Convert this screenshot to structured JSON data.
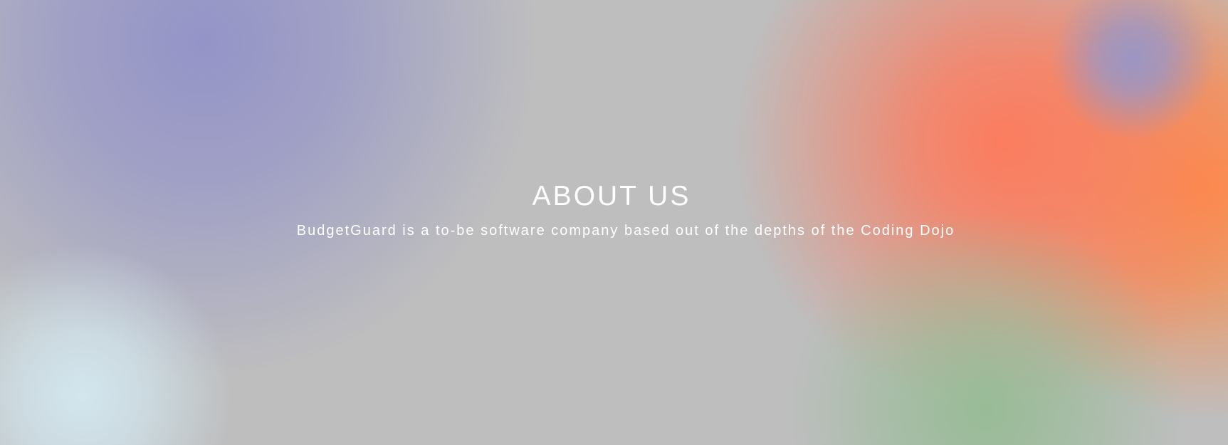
{
  "hero": {
    "title": "ABOUT US",
    "subtitle": "BudgetGuard is a to-be software company based out of the depths of the Coding Dojo"
  },
  "colors": {
    "background": "#bebebf",
    "text": "#ffffff",
    "blob_purple": "#9494c8",
    "blob_coral": "#fc7c5e",
    "blob_orange": "#fc8c48",
    "blob_green": "#96bc94",
    "blob_light_blue": "#d2e6ee",
    "blob_lavender": "#9696c8"
  }
}
